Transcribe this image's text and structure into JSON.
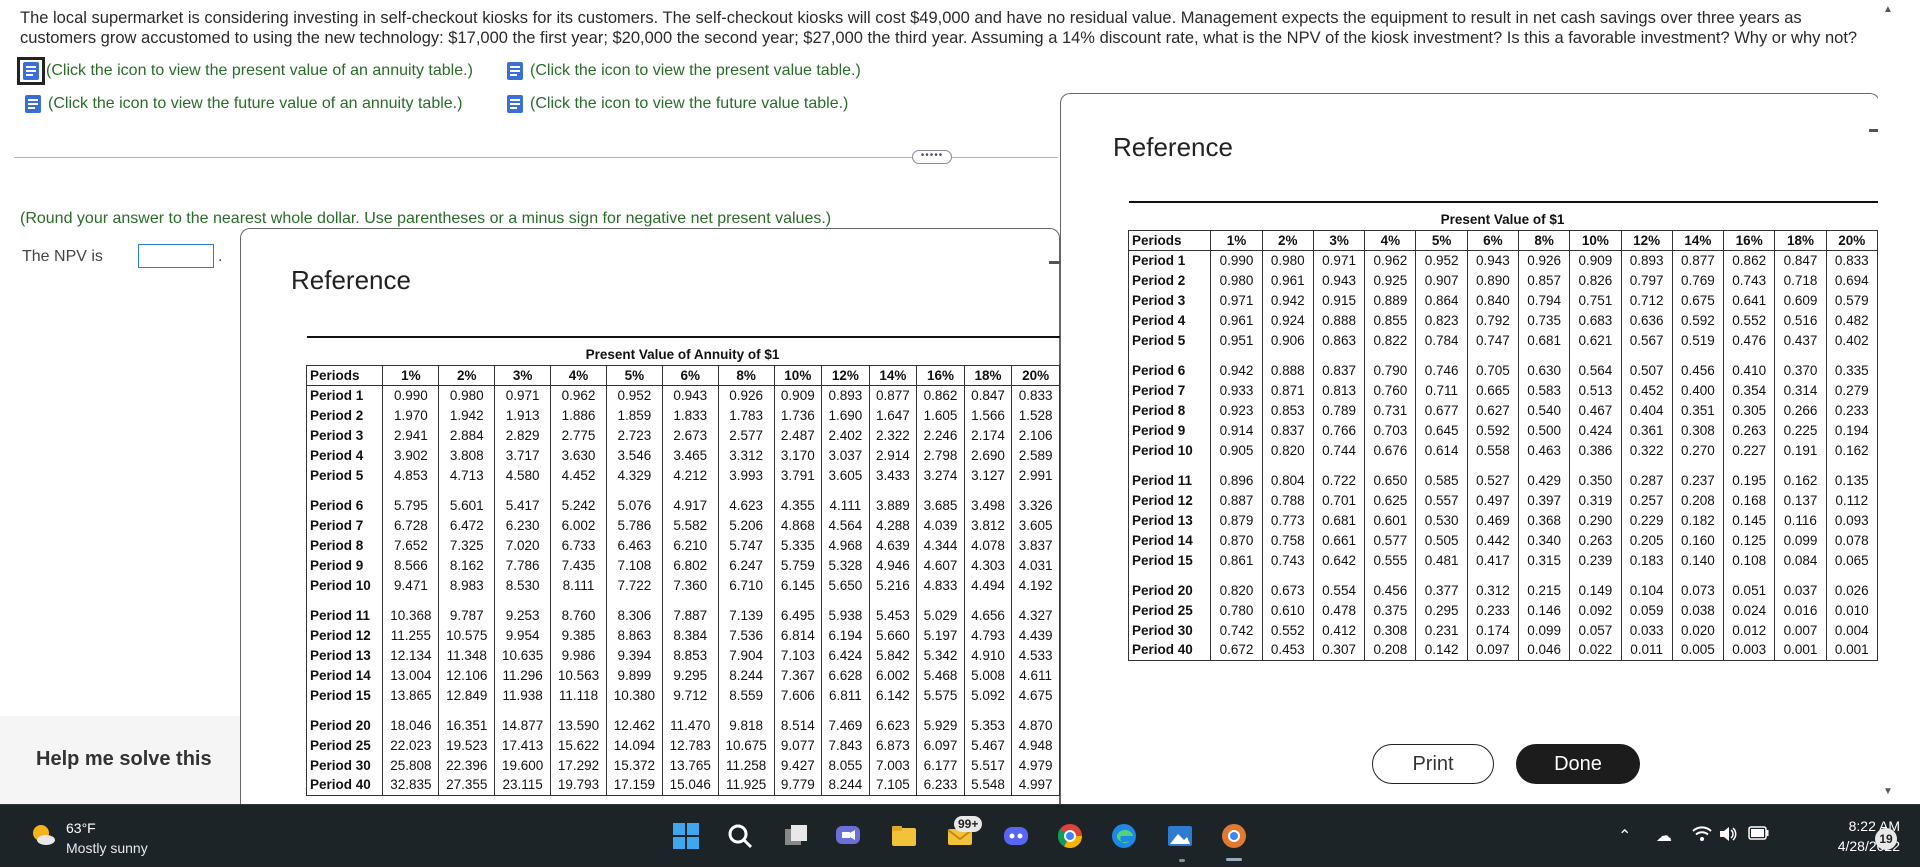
{
  "question": {
    "text": "The local supermarket is considering investing in self-checkout kiosks for its customers. The self-checkout kiosks will cost $49,000 and have no residual value. Management expects the equipment to result in net cash savings over three years as customers grow accustomed to using the new technology: $17,000 the first year; $20,000 the second year; $27,000 the third year. Assuming a 14% discount rate, what is the NPV of the kiosk investment? Is this a favorable investment? Why or why not?"
  },
  "links": {
    "pv_annuity": "(Click the icon to view the present value of an annuity table.)",
    "pv": "(Click the icon to view the present value table.)",
    "fv_annuity": "(Click the icon to view the future value of an annuity table.)",
    "fv": "(Click the icon to view the future value table.)"
  },
  "answer": {
    "round_note": "(Round your answer to the nearest whole dollar. Use parentheses or a minus sign for negative net present values.)",
    "npv_label": "The NPV is",
    "npv_value": "",
    "trailing": "."
  },
  "help": {
    "label": "Help me solve this"
  },
  "modal_annuity": {
    "title": "Reference",
    "caption": "Present Value of Annuity of $1",
    "headers": [
      "Periods",
      "1%",
      "2%",
      "3%",
      "4%",
      "5%",
      "6%",
      "8%",
      "10%",
      "12%",
      "14%",
      "16%",
      "18%",
      "20%"
    ],
    "groups": [
      [
        [
          "Period 1",
          "0.990",
          "0.980",
          "0.971",
          "0.962",
          "0.952",
          "0.943",
          "0.926",
          "0.909",
          "0.893",
          "0.877",
          "0.862",
          "0.847",
          "0.833"
        ],
        [
          "Period 2",
          "1.970",
          "1.942",
          "1.913",
          "1.886",
          "1.859",
          "1.833",
          "1.783",
          "1.736",
          "1.690",
          "1.647",
          "1.605",
          "1.566",
          "1.528"
        ],
        [
          "Period 3",
          "2.941",
          "2.884",
          "2.829",
          "2.775",
          "2.723",
          "2.673",
          "2.577",
          "2.487",
          "2.402",
          "2.322",
          "2.246",
          "2.174",
          "2.106"
        ],
        [
          "Period 4",
          "3.902",
          "3.808",
          "3.717",
          "3.630",
          "3.546",
          "3.465",
          "3.312",
          "3.170",
          "3.037",
          "2.914",
          "2.798",
          "2.690",
          "2.589"
        ],
        [
          "Period 5",
          "4.853",
          "4.713",
          "4.580",
          "4.452",
          "4.329",
          "4.212",
          "3.993",
          "3.791",
          "3.605",
          "3.433",
          "3.274",
          "3.127",
          "2.991"
        ]
      ],
      [
        [
          "Period 6",
          "5.795",
          "5.601",
          "5.417",
          "5.242",
          "5.076",
          "4.917",
          "4.623",
          "4.355",
          "4.111",
          "3.889",
          "3.685",
          "3.498",
          "3.326"
        ],
        [
          "Period 7",
          "6.728",
          "6.472",
          "6.230",
          "6.002",
          "5.786",
          "5.582",
          "5.206",
          "4.868",
          "4.564",
          "4.288",
          "4.039",
          "3.812",
          "3.605"
        ],
        [
          "Period 8",
          "7.652",
          "7.325",
          "7.020",
          "6.733",
          "6.463",
          "6.210",
          "5.747",
          "5.335",
          "4.968",
          "4.639",
          "4.344",
          "4.078",
          "3.837"
        ],
        [
          "Period 9",
          "8.566",
          "8.162",
          "7.786",
          "7.435",
          "7.108",
          "6.802",
          "6.247",
          "5.759",
          "5.328",
          "4.946",
          "4.607",
          "4.303",
          "4.031"
        ],
        [
          "Period 10",
          "9.471",
          "8.983",
          "8.530",
          "8.111",
          "7.722",
          "7.360",
          "6.710",
          "6.145",
          "5.650",
          "5.216",
          "4.833",
          "4.494",
          "4.192"
        ]
      ],
      [
        [
          "Period 11",
          "10.368",
          "9.787",
          "9.253",
          "8.760",
          "8.306",
          "7.887",
          "7.139",
          "6.495",
          "5.938",
          "5.453",
          "5.029",
          "4.656",
          "4.327"
        ],
        [
          "Period 12",
          "11.255",
          "10.575",
          "9.954",
          "9.385",
          "8.863",
          "8.384",
          "7.536",
          "6.814",
          "6.194",
          "5.660",
          "5.197",
          "4.793",
          "4.439"
        ],
        [
          "Period 13",
          "12.134",
          "11.348",
          "10.635",
          "9.986",
          "9.394",
          "8.853",
          "7.904",
          "7.103",
          "6.424",
          "5.842",
          "5.342",
          "4.910",
          "4.533"
        ],
        [
          "Period 14",
          "13.004",
          "12.106",
          "11.296",
          "10.563",
          "9.899",
          "9.295",
          "8.244",
          "7.367",
          "6.628",
          "6.002",
          "5.468",
          "5.008",
          "4.611"
        ],
        [
          "Period 15",
          "13.865",
          "12.849",
          "11.938",
          "11.118",
          "10.380",
          "9.712",
          "8.559",
          "7.606",
          "6.811",
          "6.142",
          "5.575",
          "5.092",
          "4.675"
        ]
      ],
      [
        [
          "Period 20",
          "18.046",
          "16.351",
          "14.877",
          "13.590",
          "12.462",
          "11.470",
          "9.818",
          "8.514",
          "7.469",
          "6.623",
          "5.929",
          "5.353",
          "4.870"
        ],
        [
          "Period 25",
          "22.023",
          "19.523",
          "17.413",
          "15.622",
          "14.094",
          "12.783",
          "10.675",
          "9.077",
          "7.843",
          "6.873",
          "6.097",
          "5.467",
          "4.948"
        ],
        [
          "Period 30",
          "25.808",
          "22.396",
          "19.600",
          "17.292",
          "15.372",
          "13.765",
          "11.258",
          "9.427",
          "8.055",
          "7.003",
          "6.177",
          "5.517",
          "4.979"
        ],
        [
          "Period 40",
          "32.835",
          "27.355",
          "23.115",
          "19.793",
          "17.159",
          "15.046",
          "11.925",
          "9.779",
          "8.244",
          "7.105",
          "6.233",
          "5.548",
          "4.997"
        ]
      ]
    ]
  },
  "modal_pv": {
    "title": "Reference",
    "caption": "Present Value of $1",
    "headers": [
      "Periods",
      "1%",
      "2%",
      "3%",
      "4%",
      "5%",
      "6%",
      "8%",
      "10%",
      "12%",
      "14%",
      "16%",
      "18%",
      "20%"
    ],
    "groups": [
      [
        [
          "Period 1",
          "0.990",
          "0.980",
          "0.971",
          "0.962",
          "0.952",
          "0.943",
          "0.926",
          "0.909",
          "0.893",
          "0.877",
          "0.862",
          "0.847",
          "0.833"
        ],
        [
          "Period 2",
          "0.980",
          "0.961",
          "0.943",
          "0.925",
          "0.907",
          "0.890",
          "0.857",
          "0.826",
          "0.797",
          "0.769",
          "0.743",
          "0.718",
          "0.694"
        ],
        [
          "Period 3",
          "0.971",
          "0.942",
          "0.915",
          "0.889",
          "0.864",
          "0.840",
          "0.794",
          "0.751",
          "0.712",
          "0.675",
          "0.641",
          "0.609",
          "0.579"
        ],
        [
          "Period 4",
          "0.961",
          "0.924",
          "0.888",
          "0.855",
          "0.823",
          "0.792",
          "0.735",
          "0.683",
          "0.636",
          "0.592",
          "0.552",
          "0.516",
          "0.482"
        ],
        [
          "Period 5",
          "0.951",
          "0.906",
          "0.863",
          "0.822",
          "0.784",
          "0.747",
          "0.681",
          "0.621",
          "0.567",
          "0.519",
          "0.476",
          "0.437",
          "0.402"
        ]
      ],
      [
        [
          "Period 6",
          "0.942",
          "0.888",
          "0.837",
          "0.790",
          "0.746",
          "0.705",
          "0.630",
          "0.564",
          "0.507",
          "0.456",
          "0.410",
          "0.370",
          "0.335"
        ],
        [
          "Period 7",
          "0.933",
          "0.871",
          "0.813",
          "0.760",
          "0.711",
          "0.665",
          "0.583",
          "0.513",
          "0.452",
          "0.400",
          "0.354",
          "0.314",
          "0.279"
        ],
        [
          "Period 8",
          "0.923",
          "0.853",
          "0.789",
          "0.731",
          "0.677",
          "0.627",
          "0.540",
          "0.467",
          "0.404",
          "0.351",
          "0.305",
          "0.266",
          "0.233"
        ],
        [
          "Period 9",
          "0.914",
          "0.837",
          "0.766",
          "0.703",
          "0.645",
          "0.592",
          "0.500",
          "0.424",
          "0.361",
          "0.308",
          "0.263",
          "0.225",
          "0.194"
        ],
        [
          "Period 10",
          "0.905",
          "0.820",
          "0.744",
          "0.676",
          "0.614",
          "0.558",
          "0.463",
          "0.386",
          "0.322",
          "0.270",
          "0.227",
          "0.191",
          "0.162"
        ]
      ],
      [
        [
          "Period 11",
          "0.896",
          "0.804",
          "0.722",
          "0.650",
          "0.585",
          "0.527",
          "0.429",
          "0.350",
          "0.287",
          "0.237",
          "0.195",
          "0.162",
          "0.135"
        ],
        [
          "Period 12",
          "0.887",
          "0.788",
          "0.701",
          "0.625",
          "0.557",
          "0.497",
          "0.397",
          "0.319",
          "0.257",
          "0.208",
          "0.168",
          "0.137",
          "0.112"
        ],
        [
          "Period 13",
          "0.879",
          "0.773",
          "0.681",
          "0.601",
          "0.530",
          "0.469",
          "0.368",
          "0.290",
          "0.229",
          "0.182",
          "0.145",
          "0.116",
          "0.093"
        ],
        [
          "Period 14",
          "0.870",
          "0.758",
          "0.661",
          "0.577",
          "0.505",
          "0.442",
          "0.340",
          "0.263",
          "0.205",
          "0.160",
          "0.125",
          "0.099",
          "0.078"
        ],
        [
          "Period 15",
          "0.861",
          "0.743",
          "0.642",
          "0.555",
          "0.481",
          "0.417",
          "0.315",
          "0.239",
          "0.183",
          "0.140",
          "0.108",
          "0.084",
          "0.065"
        ]
      ],
      [
        [
          "Period 20",
          "0.820",
          "0.673",
          "0.554",
          "0.456",
          "0.377",
          "0.312",
          "0.215",
          "0.149",
          "0.104",
          "0.073",
          "0.051",
          "0.037",
          "0.026"
        ],
        [
          "Period 25",
          "0.780",
          "0.610",
          "0.478",
          "0.375",
          "0.295",
          "0.233",
          "0.146",
          "0.092",
          "0.059",
          "0.038",
          "0.024",
          "0.016",
          "0.010"
        ],
        [
          "Period 30",
          "0.742",
          "0.552",
          "0.412",
          "0.308",
          "0.231",
          "0.174",
          "0.099",
          "0.057",
          "0.033",
          "0.020",
          "0.012",
          "0.007",
          "0.004"
        ],
        [
          "Period 40",
          "0.672",
          "0.453",
          "0.307",
          "0.208",
          "0.142",
          "0.097",
          "0.046",
          "0.022",
          "0.011",
          "0.005",
          "0.003",
          "0.001",
          "0.001"
        ]
      ]
    ],
    "print_label": "Print",
    "done_label": "Done"
  },
  "taskbar": {
    "temp": "63°F",
    "condition": "Mostly sunny",
    "mail_badge": "99+",
    "time": "8:22 AM",
    "date": "4/28/2022",
    "notifications": "19"
  },
  "colors": {
    "link": "#2a6b2a",
    "input_border": "#2c7fc9",
    "done_bg": "#1c1c1c",
    "taskbar": "#1d2428"
  }
}
